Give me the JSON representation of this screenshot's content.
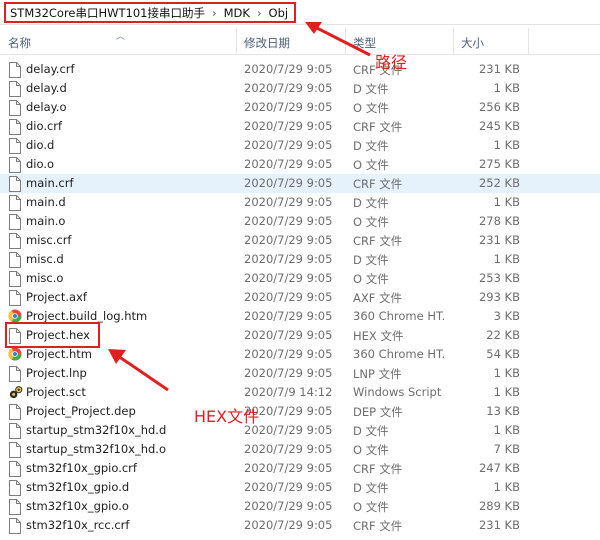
{
  "breadcrumb": {
    "parts": [
      "STM32Core串口HWT101接串口助手",
      "MDK",
      "Obj"
    ],
    "separator": "›"
  },
  "columns": {
    "name": "名称",
    "date": "修改日期",
    "type": "类型",
    "size": "大小"
  },
  "annotations": {
    "path_label": "路径",
    "hex_label": "HEX文件",
    "color": "#e02020"
  },
  "files": [
    {
      "name": "delay.crf",
      "date": "2020/7/29 9:05",
      "type": "CRF 文件",
      "size": "231 KB",
      "icon": "file-icon"
    },
    {
      "name": "delay.d",
      "date": "2020/7/29 9:05",
      "type": "D 文件",
      "size": "1 KB",
      "icon": "file-icon"
    },
    {
      "name": "delay.o",
      "date": "2020/7/29 9:05",
      "type": "O 文件",
      "size": "256 KB",
      "icon": "file-icon"
    },
    {
      "name": "dio.crf",
      "date": "2020/7/29 9:05",
      "type": "CRF 文件",
      "size": "245 KB",
      "icon": "file-icon"
    },
    {
      "name": "dio.d",
      "date": "2020/7/29 9:05",
      "type": "D 文件",
      "size": "1 KB",
      "icon": "file-icon"
    },
    {
      "name": "dio.o",
      "date": "2020/7/29 9:05",
      "type": "O 文件",
      "size": "275 KB",
      "icon": "file-icon"
    },
    {
      "name": "main.crf",
      "date": "2020/7/29 9:05",
      "type": "CRF 文件",
      "size": "252 KB",
      "icon": "file-icon",
      "selected": true
    },
    {
      "name": "main.d",
      "date": "2020/7/29 9:05",
      "type": "D 文件",
      "size": "1 KB",
      "icon": "file-icon"
    },
    {
      "name": "main.o",
      "date": "2020/7/29 9:05",
      "type": "O 文件",
      "size": "278 KB",
      "icon": "file-icon"
    },
    {
      "name": "misc.crf",
      "date": "2020/7/29 9:05",
      "type": "CRF 文件",
      "size": "231 KB",
      "icon": "file-icon"
    },
    {
      "name": "misc.d",
      "date": "2020/7/29 9:05",
      "type": "D 文件",
      "size": "1 KB",
      "icon": "file-icon"
    },
    {
      "name": "misc.o",
      "date": "2020/7/29 9:05",
      "type": "O 文件",
      "size": "253 KB",
      "icon": "file-icon"
    },
    {
      "name": "Project.axf",
      "date": "2020/7/29 9:05",
      "type": "AXF 文件",
      "size": "293 KB",
      "icon": "file-icon"
    },
    {
      "name": "Project.build_log.htm",
      "date": "2020/7/29 9:05",
      "type": "360 Chrome HT...",
      "size": "3 KB",
      "icon": "chrome-icon"
    },
    {
      "name": "Project.hex",
      "date": "2020/7/29 9:05",
      "type": "HEX 文件",
      "size": "22 KB",
      "icon": "file-icon"
    },
    {
      "name": "Project.htm",
      "date": "2020/7/29 9:05",
      "type": "360 Chrome HT...",
      "size": "54 KB",
      "icon": "chrome-icon"
    },
    {
      "name": "Project.lnp",
      "date": "2020/7/29 9:05",
      "type": "LNP 文件",
      "size": "1 KB",
      "icon": "file-icon"
    },
    {
      "name": "Project.sct",
      "date": "2020/7/9 14:12",
      "type": "Windows Script ...",
      "size": "1 KB",
      "icon": "script-icon"
    },
    {
      "name": "Project_Project.dep",
      "date": "2020/7/29 9:05",
      "type": "DEP 文件",
      "size": "13 KB",
      "icon": "file-icon"
    },
    {
      "name": "startup_stm32f10x_hd.d",
      "date": "2020/7/29 9:05",
      "type": "D 文件",
      "size": "1 KB",
      "icon": "file-icon"
    },
    {
      "name": "startup_stm32f10x_hd.o",
      "date": "2020/7/29 9:05",
      "type": "O 文件",
      "size": "7 KB",
      "icon": "file-icon"
    },
    {
      "name": "stm32f10x_gpio.crf",
      "date": "2020/7/29 9:05",
      "type": "CRF 文件",
      "size": "247 KB",
      "icon": "file-icon"
    },
    {
      "name": "stm32f10x_gpio.d",
      "date": "2020/7/29 9:05",
      "type": "D 文件",
      "size": "1 KB",
      "icon": "file-icon"
    },
    {
      "name": "stm32f10x_gpio.o",
      "date": "2020/7/29 9:05",
      "type": "O 文件",
      "size": "289 KB",
      "icon": "file-icon"
    },
    {
      "name": "stm32f10x_rcc.crf",
      "date": "2020/7/29 9:05",
      "type": "CRF 文件",
      "size": "231 KB",
      "icon": "file-icon"
    }
  ]
}
